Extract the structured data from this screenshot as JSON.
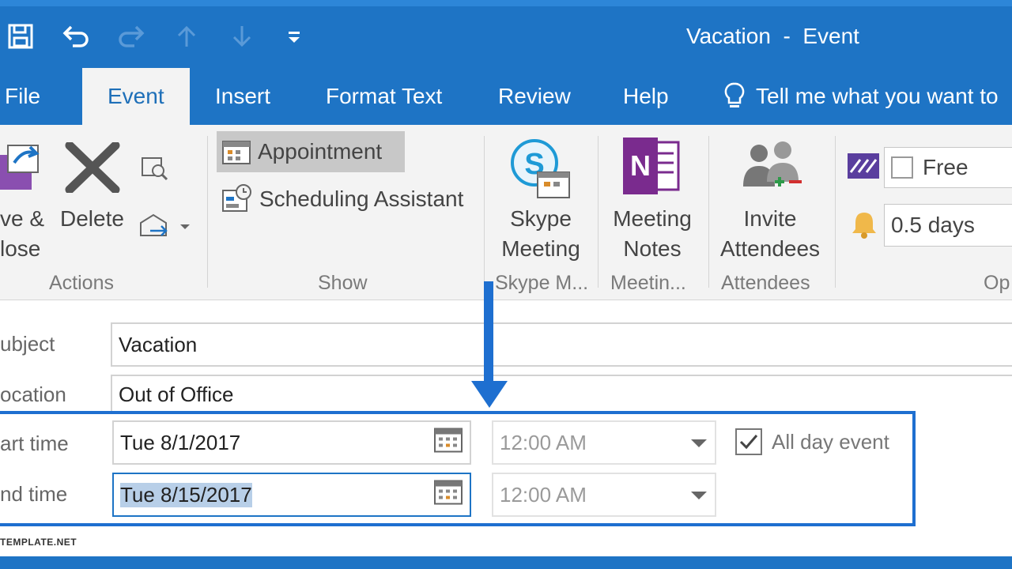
{
  "window": {
    "title": "Vacation  -  Event"
  },
  "quick_access": [
    {
      "name": "save-icon"
    },
    {
      "name": "undo-icon"
    },
    {
      "name": "redo-icon"
    },
    {
      "name": "up-arrow-icon"
    },
    {
      "name": "down-arrow-icon"
    },
    {
      "name": "customize-qat-icon"
    }
  ],
  "tabs": {
    "file": "File",
    "event": "Event",
    "insert": "Insert",
    "format_text": "Format Text",
    "review": "Review",
    "help": "Help",
    "tell_me": "Tell me what you want to"
  },
  "ribbon": {
    "actions": {
      "save_close_line1": "ve &",
      "save_close_line2": "lose",
      "delete": "Delete",
      "label": "Actions"
    },
    "show": {
      "appointment": "Appointment",
      "scheduling_assistant": "Scheduling Assistant",
      "label": "Show"
    },
    "skype": {
      "line1": "Skype",
      "line2": "Meeting",
      "label": "Skype M..."
    },
    "meeting_notes": {
      "line1": "Meeting",
      "line2": "Notes",
      "label": "Meetin..."
    },
    "attendees": {
      "line1": "Invite",
      "line2": "Attendees",
      "label": "Attendees"
    },
    "options": {
      "show_as": "Free",
      "reminder": "0.5 days",
      "label": "Op"
    }
  },
  "form": {
    "subject_label": "ubject",
    "subject_value": "Vacation",
    "location_label": "ocation",
    "location_value": "Out of Office",
    "start_label": "art time",
    "start_date": "Tue 8/1/2017",
    "start_time": "12:00 AM",
    "end_label": "nd time",
    "end_date": "Tue 8/15/2017",
    "end_time": "12:00 AM",
    "all_day_label": "All day event",
    "all_day_checked": true
  },
  "colors": {
    "accent": "#1e74c5",
    "annotation": "#1e6fd0",
    "onenote": "#7a2b8e"
  },
  "watermark": "TEMPLATE.NET"
}
